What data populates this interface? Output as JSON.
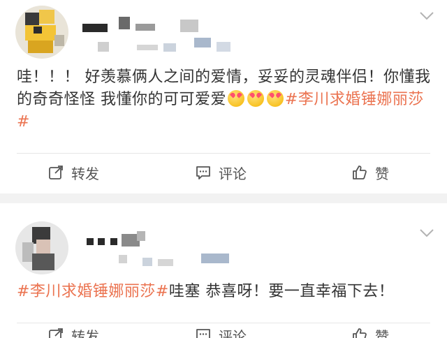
{
  "posts": [
    {
      "text_before": "哇！！！ 好羡慕俩人之间的爱情，妥妥的灵魂伴侣！你懂我的奇奇怪怪 我懂你的可可爱爱",
      "hashtag": "#李川求婚锤娜丽莎#",
      "text_after": "",
      "emoji_icon": "heart-eyes-emoji-icon",
      "actions": {
        "repost": "转发",
        "comment": "评论",
        "like": "赞"
      }
    },
    {
      "text_before": "",
      "hashtag": "#李川求婚锤娜丽莎#",
      "text_after": "哇塞 恭喜呀！要一直幸福下去！",
      "actions": {
        "repost": "转发",
        "comment": "评论",
        "like": "赞"
      }
    }
  ],
  "colors": {
    "hashtag": "#eb7350",
    "text": "#333333",
    "action": "#555555"
  }
}
